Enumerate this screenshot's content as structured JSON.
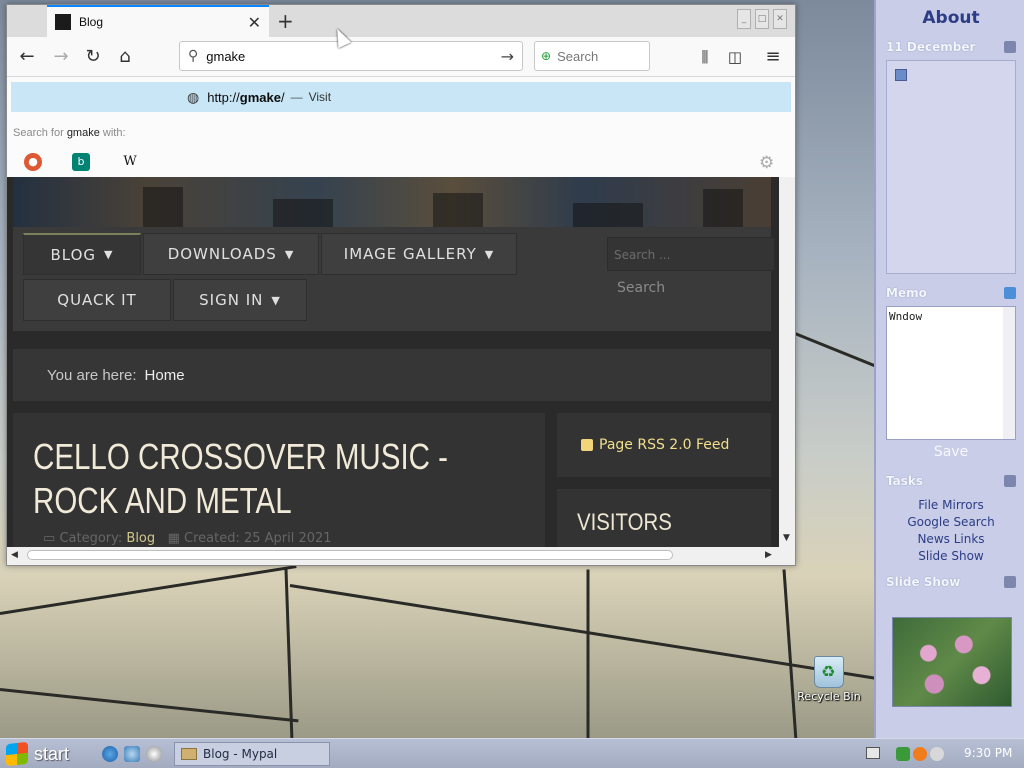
{
  "browser": {
    "tab_title": "Blog",
    "tab_close": "✕",
    "new_tab": "+",
    "url_value": "gmake",
    "search_placeholder": "Search",
    "suggestion": {
      "prefix": "http://",
      "host": "gmake",
      "suffix": "/",
      "separator": "—",
      "action": "Visit"
    },
    "search_for": {
      "prefix": "Search for",
      "term": "gmake",
      "suffix": "with:"
    },
    "engines": [
      "DuckDuckGo",
      "Bing",
      "Wikipedia"
    ],
    "wiki_glyph": "W",
    "bing_glyph": "b"
  },
  "site": {
    "menu": [
      {
        "label": "BLOG",
        "has_caret": true
      },
      {
        "label": "DOWNLOADS",
        "has_caret": true
      },
      {
        "label": "IMAGE GALLERY",
        "has_caret": true
      },
      {
        "label": "QUACK IT",
        "has_caret": false
      },
      {
        "label": "SIGN IN",
        "has_caret": true
      }
    ],
    "caret": "▼",
    "search_placeholder": "Search ...",
    "search_button": "Search",
    "breadcrumb_label": "You are here:",
    "breadcrumb_home": "Home",
    "article_title": "CELLO CROSSOVER MUSIC - ROCK AND METAL",
    "meta_category_label": "Category:",
    "meta_category": "Blog",
    "meta_created": "Created: 25 April 2021",
    "rss_label": "Page RSS 2.0 Feed",
    "visitors_label": "VISITORS"
  },
  "sidepanel": {
    "title": "About",
    "calendar_date": "11 December",
    "memo_label": "Memo",
    "memo_text": "Wndow",
    "save_label": "Save",
    "tasks_label": "Tasks",
    "tasks": [
      "File Mirrors",
      "Google Search",
      "News Links",
      "Slide Show"
    ],
    "slideshow_label": "Slide Show"
  },
  "desktop": {
    "recycle_bin": "Recycle Bin"
  },
  "taskbar": {
    "start_label": "start",
    "task_button": "Blog - Mypal",
    "clock": "9:30 PM"
  },
  "colors": {
    "tab_accent": "#0a84ff",
    "suggest_highlight": "#c8e6f6",
    "site_bg": "#2a2a2a",
    "rss_text": "#f2df8c",
    "panel_bg": "#c9cde8",
    "panel_title": "#2c3d86"
  }
}
